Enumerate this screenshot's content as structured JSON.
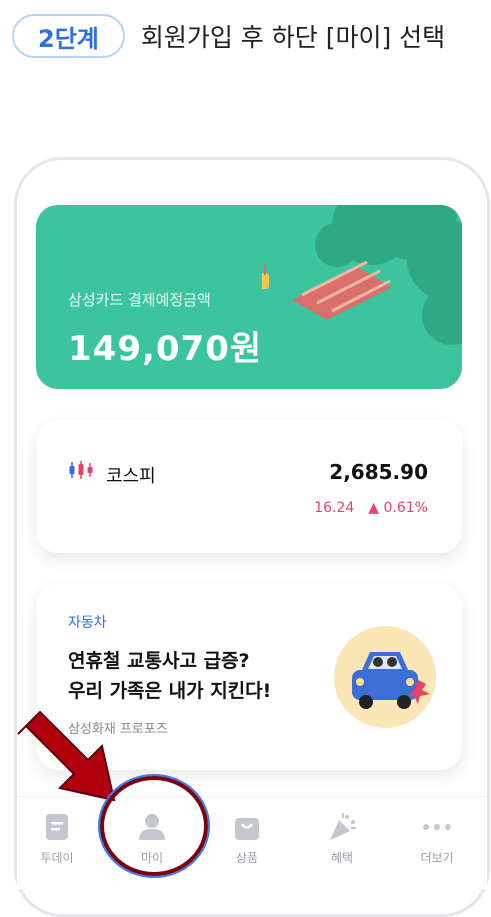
{
  "header": {
    "step_badge": "2단계",
    "step_text": "회원가입 후 하단 [마이] 선택"
  },
  "pay_card": {
    "label": "삼성카드 결제예정금액",
    "amount": "149,070원",
    "bg_color": "#3bc49e"
  },
  "kospi": {
    "name": "코스피",
    "value": "2,685.90",
    "change": "16.24",
    "change_pct": "▲ 0.61%",
    "change_color": "#e8416a"
  },
  "ad": {
    "category": "자동차",
    "title_line1": "연휴철 교통사고 급증?",
    "title_line2": "우리 가족은 내가 지킨다!",
    "subtitle": "삼성화재 프로포즈"
  },
  "tabbar": {
    "tabs": [
      {
        "label": "투데이",
        "icon": "document-icon"
      },
      {
        "label": "마이",
        "icon": "person-icon"
      },
      {
        "label": "상품",
        "icon": "shopping-bag-icon"
      },
      {
        "label": "혜택",
        "icon": "party-popper-icon"
      },
      {
        "label": "더보기",
        "icon": "more-dots-icon"
      }
    ]
  },
  "annotation": {
    "arrow_color": "#b00010",
    "circle_color": "#7a0012"
  }
}
